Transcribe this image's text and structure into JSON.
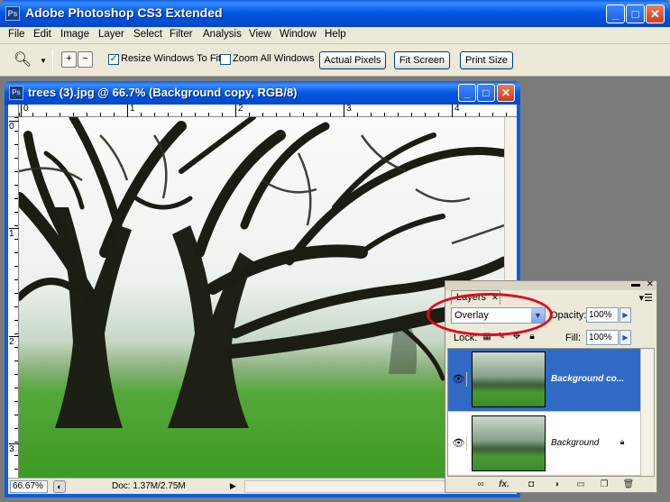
{
  "app": {
    "title": "Adobe Photoshop CS3 Extended",
    "icon_text": "Ps"
  },
  "window_buttons": {
    "minimize": "_",
    "maximize": "□",
    "close": "✕"
  },
  "menu": [
    "File",
    "Edit",
    "Image",
    "Layer",
    "Select",
    "Filter",
    "Analysis",
    "View",
    "Window",
    "Help"
  ],
  "options": {
    "resize_windows_label": "Resize Windows To Fit",
    "resize_windows_checked": true,
    "zoom_all_label": "Zoom All Windows",
    "zoom_all_checked": false,
    "actual_pixels": "Actual Pixels",
    "fit_screen": "Fit Screen",
    "print_size": "Print Size"
  },
  "document": {
    "title": "trees (3).jpg @ 66.7% (Background copy, RGB/8)",
    "icon_text": "Ps",
    "ruler_h": [
      "0",
      "1",
      "2",
      "3",
      "4"
    ],
    "ruler_v": [
      "0",
      "1",
      "2",
      "3"
    ],
    "zoom": "66.67%",
    "doc_info": "Doc: 1.37M/2.75M"
  },
  "layers_panel": {
    "tab_label": "Layers",
    "blend_mode": "Overlay",
    "opacity_label": "Opacity:",
    "opacity_value": "100%",
    "lock_label": "Lock:",
    "fill_label": "Fill:",
    "fill_value": "100%",
    "layers": [
      {
        "name": "Background co...",
        "selected": true,
        "locked": false
      },
      {
        "name": "Background",
        "selected": false,
        "locked": true
      }
    ],
    "footer_icons": [
      "link-icon",
      "fx-icon",
      "mask-icon",
      "adjustment-icon",
      "group-icon",
      "new-layer-icon",
      "trash-icon"
    ],
    "fx_text": "fx."
  },
  "colors": {
    "xp_blue": "#0058e6",
    "selection": "#316ac5",
    "annotation_red": "#e4001a"
  }
}
